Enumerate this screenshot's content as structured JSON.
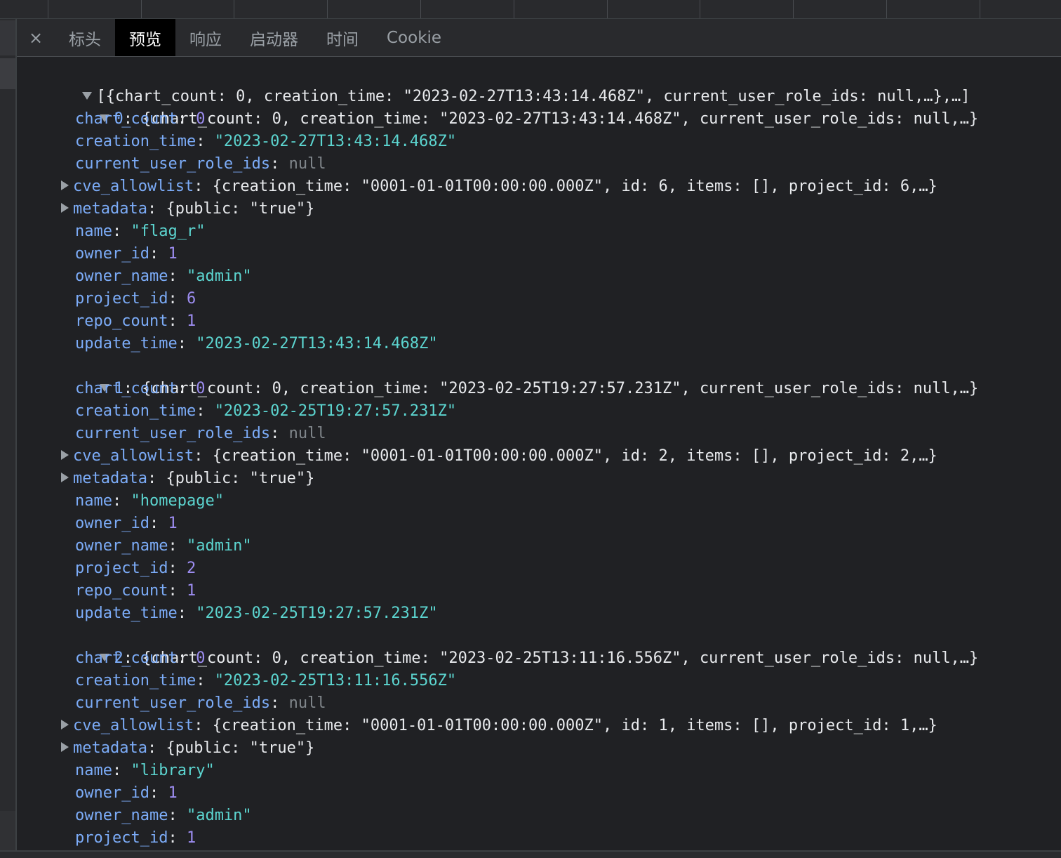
{
  "tabs": {
    "close_icon": "×",
    "items": [
      {
        "label": "标头"
      },
      {
        "label": "预览"
      },
      {
        "label": "响应"
      },
      {
        "label": "启动器"
      },
      {
        "label": "时间"
      },
      {
        "label": "Cookie"
      }
    ],
    "active": "预览"
  },
  "preview": {
    "root_summary": "[{chart_count: 0, creation_time: \"2023-02-27T13:43:14.468Z\", current_user_role_ids: null,…},…]",
    "items": [
      {
        "index": "0",
        "summary": "{chart_count: 0, creation_time: \"2023-02-27T13:43:14.468Z\", current_user_role_ids: null,…}",
        "chart_count": "0",
        "creation_time": "\"2023-02-27T13:43:14.468Z\"",
        "current_user_role_ids": "null",
        "cve_allowlist": "{creation_time: \"0001-01-01T00:00:00.000Z\", id: 6, items: [], project_id: 6,…}",
        "metadata": "{public: \"true\"}",
        "name": "\"flag_r\"",
        "owner_id": "1",
        "owner_name": "\"admin\"",
        "project_id": "6",
        "repo_count": "1",
        "update_time": "\"2023-02-27T13:43:14.468Z\""
      },
      {
        "index": "1",
        "summary": "{chart_count: 0, creation_time: \"2023-02-25T19:27:57.231Z\", current_user_role_ids: null,…}",
        "chart_count": "0",
        "creation_time": "\"2023-02-25T19:27:57.231Z\"",
        "current_user_role_ids": "null",
        "cve_allowlist": "{creation_time: \"0001-01-01T00:00:00.000Z\", id: 2, items: [], project_id: 2,…}",
        "metadata": "{public: \"true\"}",
        "name": "\"homepage\"",
        "owner_id": "1",
        "owner_name": "\"admin\"",
        "project_id": "2",
        "repo_count": "1",
        "update_time": "\"2023-02-25T19:27:57.231Z\""
      },
      {
        "index": "2",
        "summary": "{chart_count: 0, creation_time: \"2023-02-25T13:11:16.556Z\", current_user_role_ids: null,…}",
        "chart_count": "0",
        "creation_time": "\"2023-02-25T13:11:16.556Z\"",
        "current_user_role_ids": "null",
        "cve_allowlist": "{creation_time: \"0001-01-01T00:00:00.000Z\", id: 1, items: [], project_id: 1,…}",
        "metadata": "{public: \"true\"}",
        "name": "\"library\"",
        "owner_id": "1",
        "owner_name": "\"admin\"",
        "project_id": "1"
      }
    ]
  },
  "colors": {
    "background": "#202124",
    "key": "#7cacf8",
    "string": "#5cd5d0",
    "number": "#9d8df1",
    "null": "#80868b",
    "active_tab_bg": "#000000"
  }
}
